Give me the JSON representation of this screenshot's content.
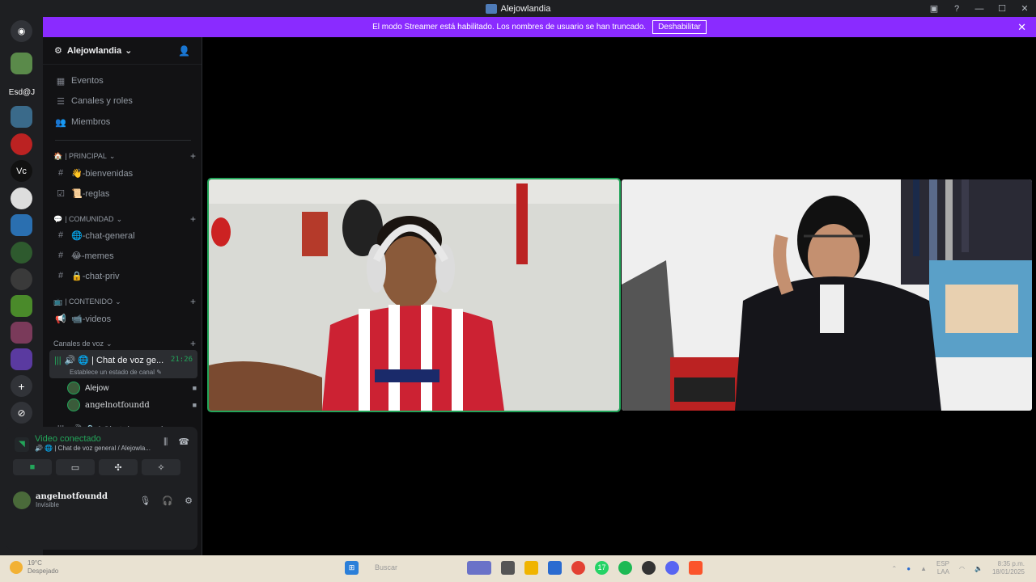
{
  "window": {
    "title": "Alejowlandia"
  },
  "guilds": [
    {
      "name": "discord-home",
      "label": ""
    },
    {
      "name": "guild-1",
      "label": ""
    },
    {
      "name": "guild-esd",
      "label": "Esd@J"
    },
    {
      "name": "guild-2",
      "label": ""
    },
    {
      "name": "guild-3",
      "label": ""
    },
    {
      "name": "guild-vc",
      "label": "Vc"
    },
    {
      "name": "guild-4",
      "label": ""
    },
    {
      "name": "guild-5",
      "label": ""
    },
    {
      "name": "guild-6",
      "label": ""
    },
    {
      "name": "guild-7",
      "label": ""
    },
    {
      "name": "guild-8",
      "label": ""
    },
    {
      "name": "guild-9",
      "label": ""
    },
    {
      "name": "guild-10",
      "label": ""
    },
    {
      "name": "add-server",
      "label": "+"
    },
    {
      "name": "discover",
      "label": "⊘"
    }
  ],
  "banner": {
    "text": "El modo Streamer está habilitado. Los nombres de usuario se han truncado.",
    "button": "Deshabilitar"
  },
  "server": {
    "name": "Alejowlandia"
  },
  "nav": {
    "events": "Eventos",
    "channels_roles": "Canales y roles",
    "members": "Miembros"
  },
  "categories": {
    "principal": "| PRINCIPAL",
    "comunidad": "| COMUNIDAD",
    "contenido": "| CONTENIDO",
    "voz": "Canales de voz"
  },
  "channels": {
    "bienvenidas": "👋-bienvenidas",
    "reglas": "📜-reglas",
    "chat_general": "🌐-chat-general",
    "memes": "😂-memes",
    "chat_priv": "🔒-chat-priv",
    "videos": "📹-videos"
  },
  "voice": {
    "active_channel": "🔊 🌐 | Chat de voz ge...",
    "timer": "21:26",
    "status": "Establece un estado de canal",
    "members": [
      "Alejow",
      "angelnotfoundd"
    ],
    "private_channel": "🔊 🔒 | Chat de voz priv"
  },
  "voice_panel": {
    "title": "Video conectado",
    "subtitle": "🔊 🌐 | Chat de voz general / Alejowla..."
  },
  "user": {
    "name": "angelnotfoundd",
    "status": "Invisible"
  },
  "taskbar": {
    "weather_temp": "19°C",
    "weather_desc": "Despejado",
    "search_placeholder": "Buscar",
    "lang": "ESP",
    "lang2": "LAA",
    "time": "8:35 p.m.",
    "date": "18/01/2025",
    "badge_whatsapp": "17"
  }
}
